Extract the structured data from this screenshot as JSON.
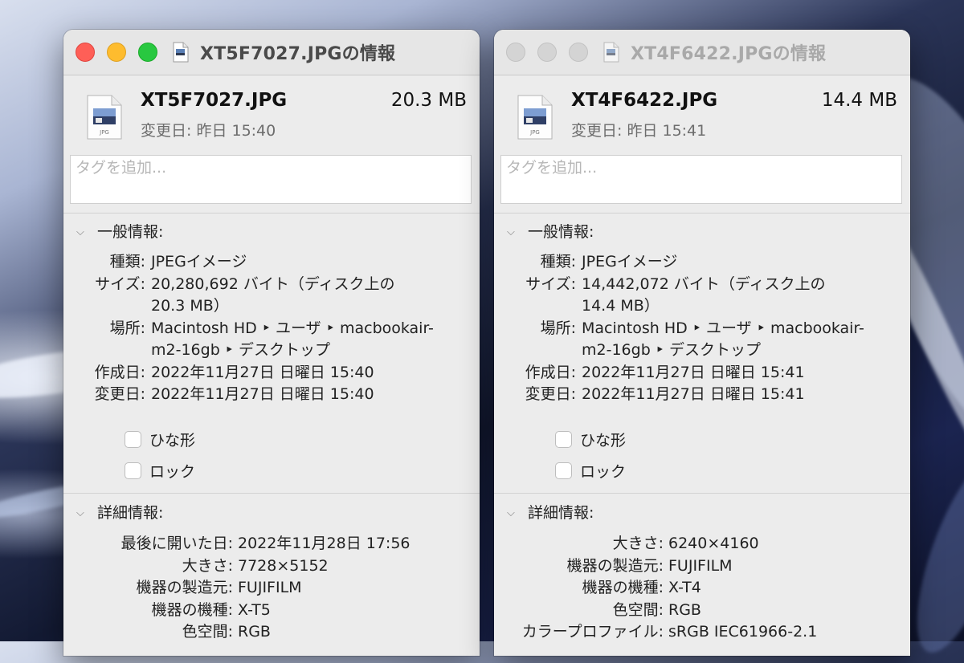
{
  "windows": [
    {
      "title": "XT5F7027.JPGの情報",
      "file_name": "XT5F7027.JPG",
      "file_size": "20.3 MB",
      "modified_short": "変更日: 昨日 15:40",
      "tags_placeholder": "タグを追加...",
      "general": {
        "header": "一般情報:",
        "kind_label": "種類:",
        "kind": "JPEGイメージ",
        "size_label": "サイズ:",
        "size_line1": "20,280,692 バイト（ディスク上の",
        "size_line2": "20.3 MB）",
        "where_label": "場所:",
        "where_line1": "Macintosh HD ‣ ユーザ ‣ macbookair-",
        "where_line2": "m2-16gb ‣ デスクトップ",
        "created_label": "作成日:",
        "created": "2022年11月27日 日曜日 15:40",
        "modified_label": "変更日:",
        "modified": "2022年11月27日 日曜日 15:40",
        "stationery_label": "ひな形",
        "locked_label": "ロック"
      },
      "more": {
        "header": "詳細情報:",
        "rows": [
          {
            "label": "最後に開いた日:",
            "value": "2022年11月28日 17:56"
          },
          {
            "label": "大きさ:",
            "value": "7728×5152"
          },
          {
            "label": "機器の製造元:",
            "value": "FUJIFILM"
          },
          {
            "label": "機器の機種:",
            "value": "X-T5"
          },
          {
            "label": "色空間:",
            "value": "RGB"
          }
        ]
      }
    },
    {
      "title": "XT4F6422.JPGの情報",
      "file_name": "XT4F6422.JPG",
      "file_size": "14.4 MB",
      "modified_short": "変更日: 昨日 15:41",
      "tags_placeholder": "タグを追加...",
      "general": {
        "header": "一般情報:",
        "kind_label": "種類:",
        "kind": "JPEGイメージ",
        "size_label": "サイズ:",
        "size_line1": "14,442,072 バイト（ディスク上の",
        "size_line2": "14.4 MB）",
        "where_label": "場所:",
        "where_line1": "Macintosh HD ‣ ユーザ ‣ macbookair-",
        "where_line2": "m2-16gb ‣ デスクトップ",
        "created_label": "作成日:",
        "created": "2022年11月27日 日曜日 15:41",
        "modified_label": "変更日:",
        "modified": "2022年11月27日 日曜日 15:41",
        "stationery_label": "ひな形",
        "locked_label": "ロック"
      },
      "more": {
        "header": "詳細情報:",
        "rows": [
          {
            "label": "大きさ:",
            "value": "6240×4160"
          },
          {
            "label": "機器の製造元:",
            "value": "FUJIFILM"
          },
          {
            "label": "機器の機種:",
            "value": "X-T4"
          },
          {
            "label": "色空間:",
            "value": "RGB"
          },
          {
            "label": "カラープロファイル:",
            "value": "sRGB IEC61966-2.1"
          }
        ]
      }
    }
  ],
  "icons": {
    "title_icon": "jpg-file-icon",
    "file_icon": "jpg-preview-icon",
    "section_toggle": "chevron-down-icon"
  },
  "colors": {
    "close": "#fe5f57",
    "minimize": "#febc2e",
    "zoom": "#28c840",
    "inactive_light": "#d4d4d4"
  }
}
